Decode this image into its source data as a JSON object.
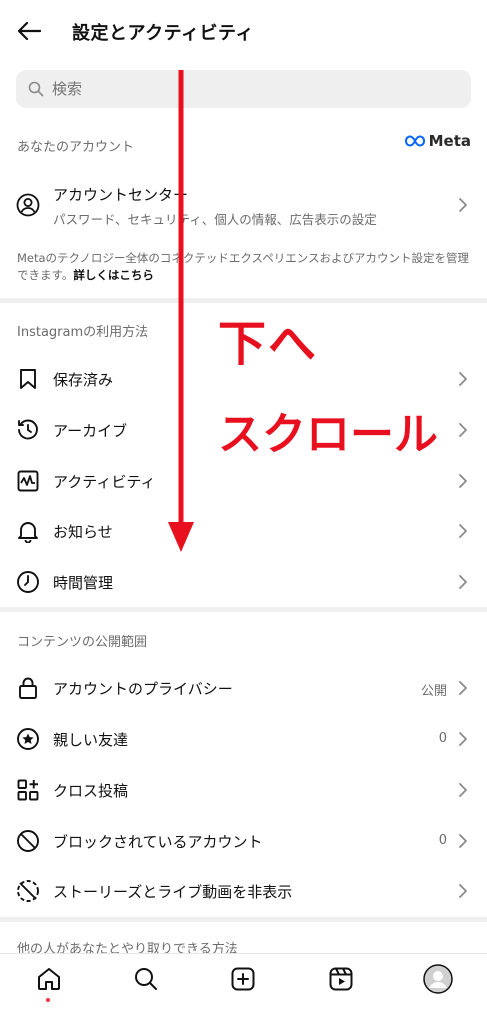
{
  "header": {
    "title": "設定とアクティビティ"
  },
  "search": {
    "placeholder": "検索"
  },
  "your_account": {
    "section_title": "あなたのアカウント",
    "meta_label": "Meta",
    "account_center": {
      "title": "アカウントセンター",
      "subtitle": "パスワード、セキュリティ、個人の情報、広告表示の設定"
    },
    "description": "Metaのテクノロジー全体のコネクテッドエクスペリエンスおよびアカウント設定を管理できます。",
    "learn_more": "詳しくはこちら"
  },
  "how_you_use": {
    "section_title": "Instagramの利用方法",
    "items": [
      {
        "label": "保存済み",
        "icon": "bookmark-icon"
      },
      {
        "label": "アーカイブ",
        "icon": "archive-icon"
      },
      {
        "label": "アクティビティ",
        "icon": "activity-icon"
      },
      {
        "label": "お知らせ",
        "icon": "bell-icon"
      },
      {
        "label": "時間管理",
        "icon": "clock-icon"
      }
    ]
  },
  "content_visibility": {
    "section_title": "コンテンツの公開範囲",
    "items": [
      {
        "label": "アカウントのプライバシー",
        "value": "公開",
        "icon": "lock-icon"
      },
      {
        "label": "親しい友達",
        "value": "0",
        "icon": "star-circle-icon"
      },
      {
        "label": "クロス投稿",
        "value": "",
        "icon": "grid-plus-icon"
      },
      {
        "label": "ブロックされているアカウント",
        "value": "0",
        "icon": "block-icon"
      },
      {
        "label": "ストーリーズとライブ動画を非表示",
        "value": "",
        "icon": "hide-story-icon"
      }
    ]
  },
  "next_section": {
    "title": "他の人があなたとやり取りできる方法"
  },
  "overlay": {
    "line1": "下へ",
    "line2": "スクロール"
  },
  "bottom_nav": [
    "home-icon",
    "search-icon",
    "create-icon",
    "reels-icon",
    "profile-icon"
  ],
  "colors": {
    "accent_red": "#e8101e",
    "divider": "#efefef",
    "muted": "#6b6b6b"
  }
}
